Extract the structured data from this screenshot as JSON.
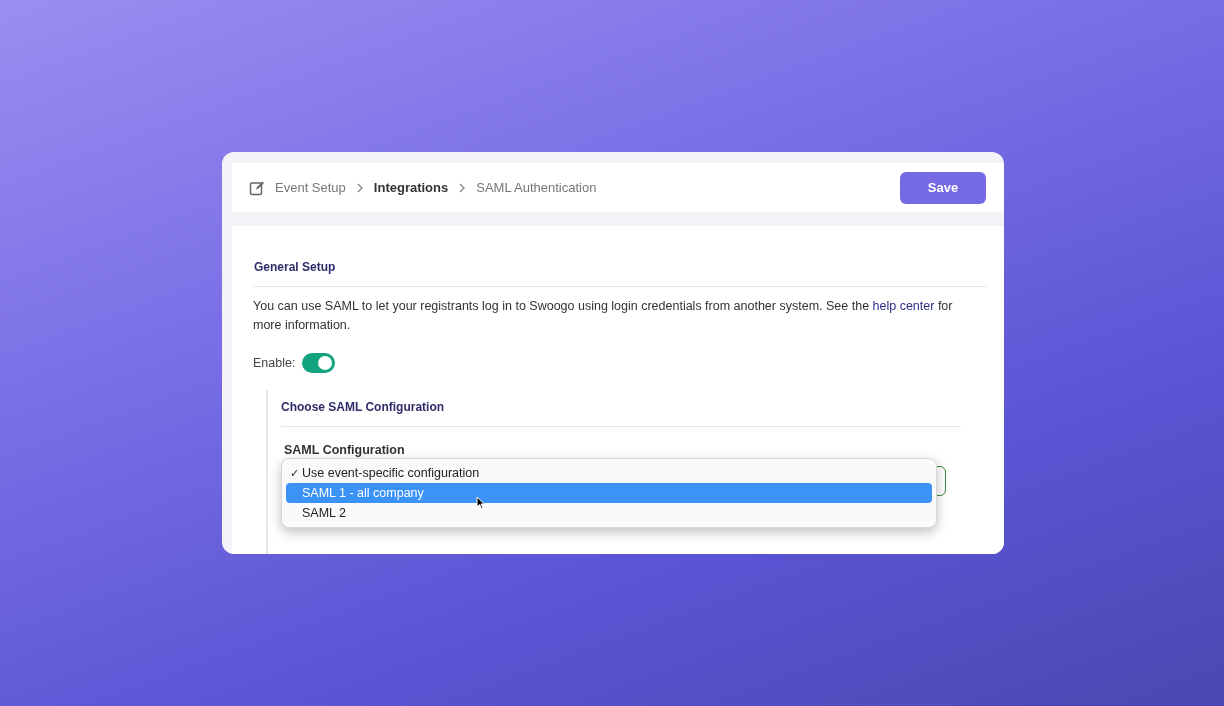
{
  "breadcrumb": [
    {
      "label": "Event Setup",
      "current": false
    },
    {
      "label": "Integrations",
      "current": true
    },
    {
      "label": "SAML Authentication",
      "current": false
    }
  ],
  "save_button": "Save",
  "general_setup": {
    "title": "General Setup",
    "description_before": "You can use SAML to let your registrants log in to Swoogo using login credentials from another system. See the ",
    "link": "help center",
    "description_after": " for more information.",
    "enable_label": "Enable:",
    "enabled": true
  },
  "saml_section": {
    "title": "Choose SAML Configuration",
    "field_label": "SAML Configuration",
    "options": [
      {
        "label": "Use event-specific configuration",
        "checked": true,
        "selected": false
      },
      {
        "label": "SAML 1 - all company",
        "checked": false,
        "selected": true
      },
      {
        "label": "SAML 2",
        "checked": false,
        "selected": false
      }
    ],
    "check_mark": "✓"
  }
}
